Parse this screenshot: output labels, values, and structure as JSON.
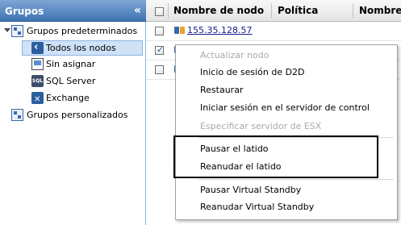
{
  "groups_panel": {
    "title": "Grupos",
    "collapse_glyph": "«",
    "tree": {
      "default_groups": "Grupos predeterminados",
      "all_nodes": "Todos los nodos",
      "unassigned": "Sin asignar",
      "sql_server": "SQL Server",
      "exchange": "Exchange",
      "custom_groups": "Grupos personalizados"
    },
    "sql_icon_text": "SQL"
  },
  "grid": {
    "columns": [
      "Nombre de nodo",
      "Política",
      "Nombre"
    ],
    "rows": [
      {
        "node": "155.35.128.57",
        "checked": false
      },
      {
        "node": "",
        "checked": true
      },
      {
        "node": "",
        "checked": false
      }
    ]
  },
  "context_menu": {
    "items": [
      {
        "label": "Actualizar nodo",
        "enabled": false
      },
      {
        "label": "Inicio de sesión de D2D",
        "enabled": true
      },
      {
        "label": "Restaurar",
        "enabled": true
      },
      {
        "label": "Iniciar sesión en el servidor de control",
        "enabled": true
      },
      {
        "label": "Especificar servidor de ESX",
        "enabled": false
      },
      {
        "label": "Pausar el latido",
        "enabled": true
      },
      {
        "label": "Reanudar el latido",
        "enabled": true
      },
      {
        "label": "Pausar Virtual Standby",
        "enabled": true
      },
      {
        "label": "Reanudar Virtual Standby",
        "enabled": true
      }
    ]
  },
  "colors": {
    "header_blue": "#3f73b4",
    "selection": "#cfe2f8",
    "disabled_text": "#a9a9a9",
    "link": "#1a1a8c"
  }
}
